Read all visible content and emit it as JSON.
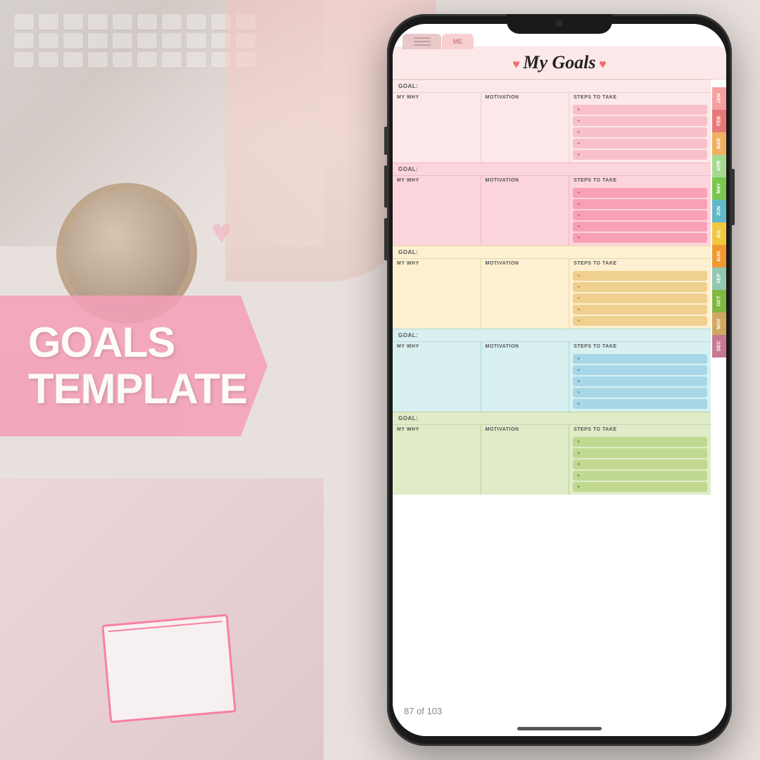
{
  "background": {
    "color": "#e0d8d4"
  },
  "label": {
    "text_line1": "GOALS",
    "text_line2": "TEMPLATE"
  },
  "phone": {
    "page_counter": "87 of 103"
  },
  "planner": {
    "title": "My Goals",
    "tab_label": "ME",
    "goals": [
      {
        "id": 1,
        "color": "#fce8e8",
        "step_color": "#f8c0c8",
        "step_line_color": "#f4a8b4",
        "header_bg": "#fce8e8",
        "label": "GOAL:",
        "columns": [
          "MY WHY",
          "MOTIVATION",
          "STEPS TO TAKE"
        ],
        "step_count": 5
      },
      {
        "id": 2,
        "color": "#fce8e8",
        "step_color": "#f8b0c0",
        "step_line_color": "#f49aac",
        "header_bg": "#fce8e8",
        "label": "GOAL:",
        "columns": [
          "MY WHY",
          "MOTIVATION",
          "STEPS TO TAKE"
        ],
        "step_count": 5
      },
      {
        "id": 3,
        "color": "#fdf4e0",
        "step_color": "#f0d898",
        "step_line_color": "#e8c880",
        "header_bg": "#fdf4e0",
        "label": "GOAL:",
        "columns": [
          "MY WHY",
          "MOTIVATION",
          "STEPS TO TAKE"
        ],
        "step_count": 5
      },
      {
        "id": 4,
        "color": "#e0f4f4",
        "step_color": "#b8e4e4",
        "step_line_color": "#a0d4d4",
        "header_bg": "#e0f4f4",
        "label": "GOAL:",
        "columns": [
          "MY WHY",
          "MOTIVATION",
          "STEPS TO TAKE"
        ],
        "step_count": 5
      },
      {
        "id": 5,
        "color": "#e8f0d8",
        "step_color": "#ccd8a8",
        "step_line_color": "#b8c890",
        "header_bg": "#e8f0d8",
        "label": "GOAL:",
        "columns": [
          "MY WHY",
          "MOTIVATION",
          "STEPS TO TAKE"
        ],
        "step_count": 5
      }
    ],
    "months": [
      {
        "label": "JAN",
        "color": "#f4a0a0"
      },
      {
        "label": "FEB",
        "color": "#e87878"
      },
      {
        "label": "MAR",
        "color": "#f0b060"
      },
      {
        "label": "APR",
        "color": "#a8d890"
      },
      {
        "label": "MAY",
        "color": "#78c850"
      },
      {
        "label": "JUN",
        "color": "#60b8c8"
      },
      {
        "label": "JUL",
        "color": "#f0c840"
      },
      {
        "label": "AUG",
        "color": "#f09830"
      },
      {
        "label": "SEP",
        "color": "#90c8b0"
      },
      {
        "label": "OCT",
        "color": "#80b840"
      },
      {
        "label": "NOV",
        "color": "#d0a860"
      },
      {
        "label": "DEC",
        "color": "#c87890"
      }
    ]
  }
}
